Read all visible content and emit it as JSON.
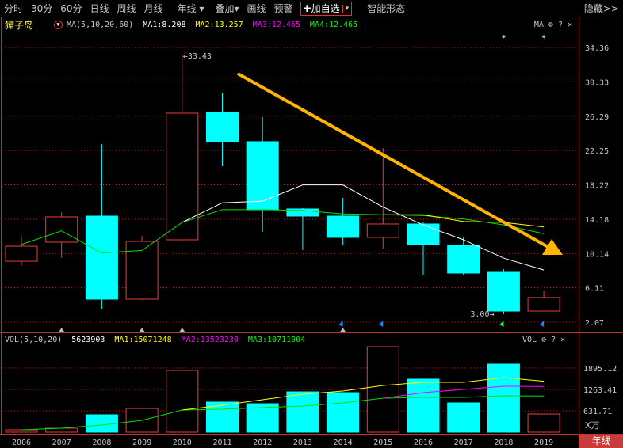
{
  "toolbar": {
    "items": [
      "分时",
      "30分",
      "60分",
      "日线",
      "周线",
      "月线",
      "年线 ▾",
      "叠加▾",
      "画线",
      "预警"
    ],
    "add_watch": "✚加自选",
    "add_watch_dropdown": "▾",
    "smart": "智能形态",
    "hide": "隐藏>>"
  },
  "price_panel": {
    "stock_name": "獐子岛",
    "indicator": "MA(5,10,20,60)",
    "ma1": "MA1:8.208",
    "ma2": "MA2:13.257",
    "ma3": "MA3:12.465",
    "ma4": "MA4:12.465",
    "tool_label": "MA",
    "high_label": "←33.43",
    "low_label": "3.00→"
  },
  "volume_panel": {
    "indicator": "VOL(5,10,20)",
    "value": "5623903",
    "ma1": "MA1:15071248",
    "ma2": "MA2:13523230",
    "ma3": "MA3:10711904",
    "tool_label": "VOL",
    "unit": "X万"
  },
  "period_button": "年线",
  "colors": {
    "up": "#e83c3c",
    "down": "#00ffff",
    "ma_white": "#ffffff",
    "ma_yellow": "#ffff00",
    "ma_magenta": "#ff00ff",
    "ma_green": "#00e000",
    "arrow": "#ffb400"
  },
  "chart_data": {
    "type": "candlestick",
    "categories": [
      "2006",
      "2007",
      "2008",
      "2009",
      "2010",
      "2011",
      "2012",
      "2013",
      "2014",
      "2015",
      "2016",
      "2017",
      "2018",
      "2019"
    ],
    "price_ticks": [
      "34.36",
      "30.33",
      "26.29",
      "22.25",
      "18.22",
      "14.18",
      "10.14",
      "6.11",
      "2.07"
    ],
    "price_range": [
      2.07,
      34.36
    ],
    "ohlc": [
      [
        9.23,
        12.21,
        8.68,
        11.0
      ],
      [
        11.47,
        15.0,
        9.61,
        14.45
      ],
      [
        14.54,
        23.0,
        3.65,
        4.77
      ],
      [
        4.77,
        12.21,
        4.68,
        11.56
      ],
      [
        11.75,
        33.43,
        11.6,
        26.64
      ],
      [
        26.73,
        28.96,
        20.4,
        23.29
      ],
      [
        23.29,
        26.17,
        12.68,
        15.28
      ],
      [
        15.38,
        15.47,
        10.54,
        14.54
      ],
      [
        14.54,
        16.68,
        11.1,
        12.03
      ],
      [
        12.03,
        22.54,
        10.72,
        13.61
      ],
      [
        13.61,
        13.89,
        7.65,
        11.19
      ],
      [
        11.1,
        12.12,
        7.56,
        7.84
      ],
      [
        7.93,
        8.3,
        3.0,
        3.37
      ],
      [
        3.37,
        5.7,
        3.3,
        4.96
      ]
    ],
    "ma_white": [
      null,
      null,
      null,
      null,
      13.8,
      16.1,
      16.3,
      18.2,
      18.2,
      15.6,
      13.5,
      11.75,
      9.6,
      8.2
    ],
    "ma_yellow": [
      null,
      null,
      null,
      null,
      null,
      null,
      null,
      null,
      null,
      14.7,
      14.7,
      13.9,
      13.8,
      13.26
    ],
    "ma_green": [
      11.2,
      12.8,
      10.2,
      10.5,
      13.8,
      15.3,
      15.3,
      15.2,
      14.8,
      14.7,
      14.6,
      14.2,
      13.5,
      12.47
    ],
    "volume_ticks": [
      "1895.12",
      "1263.41",
      "631.71"
    ],
    "volume": [
      70,
      117,
      515,
      700,
      1825,
      890,
      842,
      1193,
      1170,
      2527,
      1568,
      866,
      2012,
      538
    ],
    "vol_ma_yellow": [
      null,
      null,
      null,
      null,
      655,
      796,
      960,
      1123,
      1217,
      1380,
      1474,
      1474,
      1615,
      1507
    ],
    "vol_ma_magenta": [
      null,
      null,
      null,
      null,
      null,
      null,
      null,
      null,
      null,
      1006,
      1170,
      1263,
      1357,
      1352
    ],
    "vol_ma_green": [
      70,
      117,
      211,
      351,
      655,
      679,
      725,
      772,
      866,
      1006,
      1030,
      1030,
      1076,
      1071
    ],
    "grey_markers": [
      "2007",
      "2009",
      "2010",
      "2014"
    ],
    "blue_flags": [
      "2014",
      "2015",
      "2019"
    ],
    "green_flags": [
      "2018"
    ],
    "star_markers": [
      "2018",
      "2019"
    ]
  }
}
